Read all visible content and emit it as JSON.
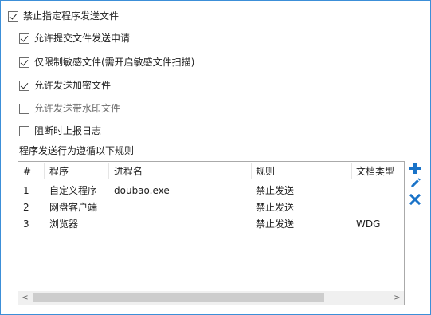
{
  "options": [
    {
      "label": "禁止指定程序发送文件",
      "checked": true,
      "disabled": false
    },
    {
      "label": "允许提交文件发送申请",
      "checked": true,
      "disabled": false
    },
    {
      "label": "仅限制敏感文件(需开启敏感文件扫描)",
      "checked": true,
      "disabled": false
    },
    {
      "label": "允许发送加密文件",
      "checked": true,
      "disabled": false
    },
    {
      "label": "允许发送带水印文件",
      "checked": false,
      "disabled": true
    },
    {
      "label": "阻断时上报日志",
      "checked": false,
      "disabled": false
    }
  ],
  "rules_label": "程序发送行为遵循以下规则",
  "table": {
    "columns": [
      "#",
      "程序",
      "进程名",
      "规则",
      "文档类型"
    ],
    "rows": [
      [
        "1",
        "自定义程序",
        "doubao.exe",
        "禁止发送",
        ""
      ],
      [
        "2",
        "网盘客户端",
        "",
        "禁止发送",
        ""
      ],
      [
        "3",
        "浏览器",
        "",
        "禁止发送",
        "WDG"
      ]
    ]
  },
  "scrollbar": {
    "left_arrow": "<",
    "right_arrow": ">"
  },
  "tools": {
    "add": "add-icon",
    "edit": "edit-icon",
    "delete": "delete-icon",
    "accent": "#1a73c8"
  }
}
